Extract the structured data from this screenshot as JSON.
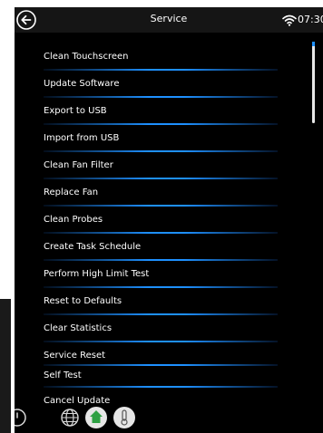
{
  "header": {
    "title": "Service",
    "time": "07:30",
    "back_icon": "arrow-left-circle-icon",
    "wifi_icon": "wifi-icon"
  },
  "menu": {
    "items": [
      {
        "label": "Clean Touchscreen"
      },
      {
        "label": "Update Software"
      },
      {
        "label": "Export to USB"
      },
      {
        "label": "Import from USB"
      },
      {
        "label": "Clean Fan Filter"
      },
      {
        "label": "Replace Fan"
      },
      {
        "label": "Clean Probes"
      },
      {
        "label": "Create Task Schedule"
      },
      {
        "label": "Perform High Limit Test"
      },
      {
        "label": "Reset to Defaults"
      },
      {
        "label": "Clear Statistics"
      },
      {
        "label": "Service Reset"
      },
      {
        "label": "Self Test"
      },
      {
        "label": "Cancel Update"
      }
    ]
  },
  "bottom_bar": {
    "icons": [
      "power-icon",
      "globe-icon",
      "home-icon",
      "temperature-icon"
    ]
  },
  "colors": {
    "accent": "#1e90ff",
    "background": "#000000",
    "text": "#ffffff"
  }
}
